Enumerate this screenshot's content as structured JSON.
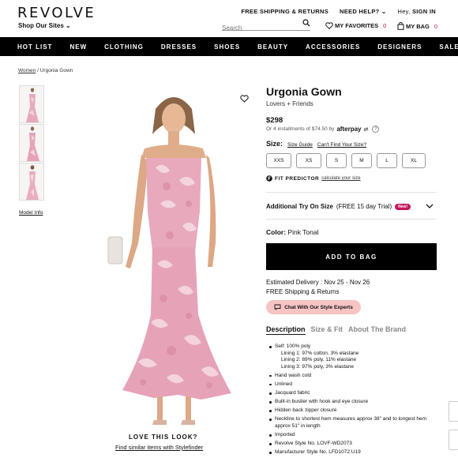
{
  "header": {
    "logo": "REVOLVE",
    "shop_sites": "Shop Our Sites",
    "free_shipping": "FREE SHIPPING & RETURNS",
    "need_help": "NEED HELP?",
    "greeting": "Hey,",
    "sign_in": "SIGN IN",
    "search_placeholder": "Search",
    "favorites_label": "MY FAVORITES",
    "favorites_count": "0",
    "bag_label": "MY BAG",
    "bag_count": "0"
  },
  "nav": {
    "items": [
      "HOT LIST",
      "NEW",
      "CLOTHING",
      "DRESSES",
      "SHOES",
      "BEAUTY",
      "ACCESSORIES",
      "DESIGNERS",
      "SALE"
    ]
  },
  "breadcrumb": {
    "parent": "Women",
    "separator": "/",
    "current": "Urgonia Gown"
  },
  "gallery": {
    "model_info": "Model Info",
    "love_this_look": "LOVE THIS LOOK?",
    "find_similar": "Find similar items with Stylefinder"
  },
  "product": {
    "name": "Urgonia Gown",
    "brand": "Lovers + Friends",
    "price": "$298",
    "installments": "Or 4 installments of $74.50 by",
    "afterpay_label": "afterpay",
    "size_label": "Size:",
    "size_guide": "Size Guide",
    "cant_find_size": "Can't Find Your Size?",
    "sizes": [
      "XXS",
      "XS",
      "S",
      "M",
      "L",
      "XL"
    ],
    "fit_predictor": "FIT PREDICTOR",
    "calculate_size": "calculate your size",
    "try_on_title": "Additional Try On Size",
    "try_on_detail": "(FREE 15 day Trial)",
    "new_badge": "New!",
    "color_label": "Color:",
    "color_value": "Pink Tonal",
    "add_to_bag": "ADD TO BAG",
    "estimated_delivery": "Estimated Delivery : Nov 25 - Nov 26",
    "free_shipping": "FREE Shipping & Returns",
    "chat": "Chat With Our Style Experts"
  },
  "tabs": [
    "Description",
    "Size & Fit",
    "About The Brand"
  ],
  "description": {
    "self": "Self: 100% poly",
    "linings": [
      "Lining 1: 97% cotton, 3% elastane",
      "Lining 2: 89% poly, 11% elastane",
      "Lining 3: 97% poly, 3% elastane"
    ],
    "bullets": [
      "Hand wash cold",
      "Unlined",
      "Jacquard fabric",
      "Built-in bustier with hook and eye closure",
      "Hidden back zipper closure",
      "Neckline to shortest hem measures approx 38\" and to longest hem approx 51\" in length",
      "Imported",
      "Revolve Style No. LOVF-WD2073",
      "Manufacturer Style No. LFD1072 U19"
    ]
  },
  "colors": {
    "accent_pink": "#c2185b",
    "chat_bg": "#f7c4c4",
    "dress_pink": "#e8a9bd",
    "nav_bg": "#000000"
  }
}
